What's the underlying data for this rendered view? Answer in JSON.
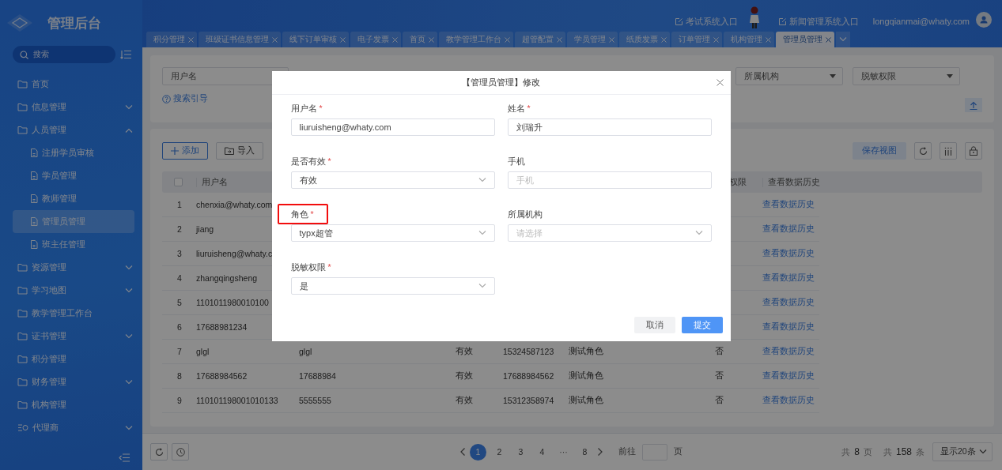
{
  "app": {
    "title": "管理后台"
  },
  "sidebar": {
    "search_placeholder": "搜索",
    "items": [
      {
        "label": "首页",
        "kind": "folder",
        "selected": false
      },
      {
        "label": "信息管理",
        "kind": "folder",
        "selected": false,
        "expanded": false
      },
      {
        "label": "人员管理",
        "kind": "folder",
        "selected": false,
        "expanded": true,
        "children": [
          {
            "label": "注册学员审核",
            "kind": "page",
            "selected": false
          },
          {
            "label": "学员管理",
            "kind": "page",
            "selected": false
          },
          {
            "label": "教师管理",
            "kind": "page",
            "selected": false
          },
          {
            "label": "管理员管理",
            "kind": "page",
            "selected": true
          },
          {
            "label": "班主任管理",
            "kind": "page",
            "selected": false
          }
        ]
      },
      {
        "label": "资源管理",
        "kind": "folder",
        "selected": false,
        "expanded": false
      },
      {
        "label": "学习地图",
        "kind": "folder",
        "selected": false,
        "expanded": false
      },
      {
        "label": "教学管理工作台",
        "kind": "folder",
        "selected": false
      },
      {
        "label": "证书管理",
        "kind": "folder",
        "selected": false,
        "expanded": false
      },
      {
        "label": "积分管理",
        "kind": "folder",
        "selected": false
      },
      {
        "label": "财务管理",
        "kind": "folder",
        "selected": false,
        "expanded": false
      },
      {
        "label": "机构管理",
        "kind": "folder",
        "selected": false
      },
      {
        "label": "代理商",
        "kind": "hub",
        "selected": false,
        "expanded": false
      }
    ]
  },
  "header": {
    "links": [
      {
        "label": "考试系统入口"
      },
      {
        "label": "新闻管理系统入口"
      }
    ],
    "user": "longqianmai@whaty.com"
  },
  "tabs": [
    {
      "label": "积分管理",
      "selected": false
    },
    {
      "label": "班级证书信息管理",
      "selected": false
    },
    {
      "label": "线下订单审核",
      "selected": false
    },
    {
      "label": "电子发票",
      "selected": false
    },
    {
      "label": "首页",
      "selected": false
    },
    {
      "label": "教学管理工作台",
      "selected": false
    },
    {
      "label": "超管配置",
      "selected": false
    },
    {
      "label": "学员管理",
      "selected": false
    },
    {
      "label": "纸质发票",
      "selected": false
    },
    {
      "label": "订单管理",
      "selected": false
    },
    {
      "label": "机构管理",
      "selected": false
    },
    {
      "label": "管理员管理",
      "selected": true
    }
  ],
  "filters": {
    "fields": [
      {
        "label": "用户名",
        "kind": "field"
      },
      {
        "label": "所属机构",
        "kind": "select"
      },
      {
        "label": "脱敏权限",
        "kind": "select"
      }
    ],
    "guide": "搜索引导"
  },
  "toolbar": {
    "add": "添加",
    "import": "导入",
    "save_view": "保存视图"
  },
  "table": {
    "header": {
      "select_all_checked": false,
      "username": "用户名",
      "desensitize": "权限",
      "history": "查看数据历史"
    },
    "rows": [
      {
        "index": "1",
        "username": "chenxia@whaty.com",
        "history": "查看数据历史"
      },
      {
        "index": "2",
        "username": "jiang",
        "history": "查看数据历史"
      },
      {
        "index": "3",
        "username": "liuruisheng@whaty.c",
        "history": "查看数据历史"
      },
      {
        "index": "4",
        "username": "zhangqingsheng",
        "history": "查看数据历史"
      },
      {
        "index": "5",
        "username": "1101011980010100",
        "history": "查看数据历史"
      },
      {
        "index": "6",
        "username": "17688981234",
        "history": "查看数据历史"
      },
      {
        "index": "7",
        "username": "glgl",
        "name": "glgl",
        "valid": "有效",
        "phone": "15324587123",
        "role": "测试角色",
        "desensitize": "否",
        "history": "查看数据历史"
      },
      {
        "index": "8",
        "username": "17688984562",
        "name": "17688984",
        "valid": "有效",
        "phone": "17688984562",
        "role": "测试角色",
        "desensitize": "否",
        "history": "查看数据历史"
      },
      {
        "index": "9",
        "username": "110101198001010133",
        "name": "5555555",
        "valid": "有效",
        "phone": "15312358974",
        "role": "测试角色",
        "desensitize": "否",
        "history": "查看数据历史"
      }
    ]
  },
  "pagination": {
    "pages": [
      {
        "label": "1",
        "kind": "page",
        "selected": true
      },
      {
        "label": "2",
        "kind": "page",
        "selected": false
      },
      {
        "label": "3",
        "kind": "page",
        "selected": false
      },
      {
        "label": "4",
        "kind": "page",
        "selected": false
      },
      {
        "label": "···",
        "kind": "ellipsis",
        "selected": false
      },
      {
        "label": "8",
        "kind": "page",
        "selected": false
      }
    ],
    "goto_before": "前往",
    "goto_after": "页",
    "total_pages": {
      "before": "共",
      "value": "8",
      "after": "页"
    },
    "total_items": {
      "before": "共",
      "value": "158",
      "after": "条"
    },
    "page_size": "显示20条"
  },
  "modal": {
    "title": "【管理员管理】修改",
    "fields": [
      {
        "label": "用户名",
        "required_mark": "*",
        "kind": "input",
        "value": "liuruisheng@whaty.com",
        "highlighted": false
      },
      {
        "label": "姓名",
        "required_mark": "*",
        "kind": "input",
        "value": "刘瑞升",
        "highlighted": false
      },
      {
        "label": "是否有效",
        "required_mark": "*",
        "kind": "select",
        "value": "有效",
        "highlighted": false
      },
      {
        "label": "手机",
        "kind": "input",
        "placeholder": "手机",
        "highlighted": false
      },
      {
        "label": "角色",
        "required_mark": "*",
        "kind": "select",
        "value": "typx超管",
        "highlighted": true
      },
      {
        "label": "所属机构",
        "kind": "select",
        "placeholder": "请选择",
        "highlighted": false
      },
      {
        "label": "脱敏权限",
        "required_mark": "*",
        "kind": "select",
        "value": "是",
        "highlighted": false
      }
    ],
    "cancel": "取消",
    "submit": "提交"
  }
}
